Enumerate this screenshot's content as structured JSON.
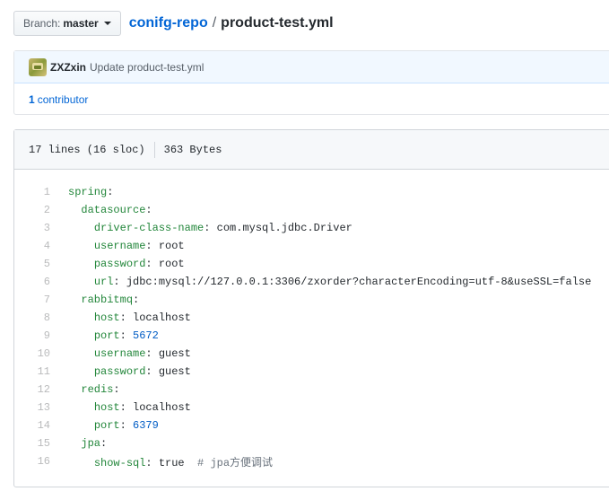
{
  "branch": {
    "prefix": "Branch:",
    "name": "master"
  },
  "breadcrumb": {
    "repo": "conifg-repo",
    "separator": "/",
    "file": "product-test.yml"
  },
  "commit": {
    "author": "ZXZxin",
    "message": "Update product-test.yml"
  },
  "contributors": {
    "count": "1",
    "label": "contributor"
  },
  "file_info": {
    "lines": "17 lines (16 sloc)",
    "size": "363 Bytes"
  },
  "code_lines": [
    {
      "n": "1",
      "indent": "",
      "key": "spring",
      "colon": ":",
      "value": "",
      "vclass": "",
      "comment": ""
    },
    {
      "n": "2",
      "indent": "  ",
      "key": "datasource",
      "colon": ":",
      "value": "",
      "vclass": "",
      "comment": ""
    },
    {
      "n": "3",
      "indent": "    ",
      "key": "driver-class-name",
      "colon": ": ",
      "value": "com.mysql.jdbc.Driver",
      "vclass": "",
      "comment": ""
    },
    {
      "n": "4",
      "indent": "    ",
      "key": "username",
      "colon": ": ",
      "value": "root",
      "vclass": "",
      "comment": ""
    },
    {
      "n": "5",
      "indent": "    ",
      "key": "password",
      "colon": ": ",
      "value": "root",
      "vclass": "",
      "comment": ""
    },
    {
      "n": "6",
      "indent": "    ",
      "key": "url",
      "colon": ": ",
      "value": "jdbc:mysql://127.0.0.1:3306/zxorder?characterEncoding=utf-8&useSSL=false",
      "vclass": "",
      "comment": ""
    },
    {
      "n": "7",
      "indent": "  ",
      "key": "rabbitmq",
      "colon": ":",
      "value": "",
      "vclass": "",
      "comment": ""
    },
    {
      "n": "8",
      "indent": "    ",
      "key": "host",
      "colon": ": ",
      "value": "localhost",
      "vclass": "",
      "comment": ""
    },
    {
      "n": "9",
      "indent": "    ",
      "key": "port",
      "colon": ": ",
      "value": "5672",
      "vclass": "n",
      "comment": ""
    },
    {
      "n": "10",
      "indent": "    ",
      "key": "username",
      "colon": ": ",
      "value": "guest",
      "vclass": "",
      "comment": ""
    },
    {
      "n": "11",
      "indent": "    ",
      "key": "password",
      "colon": ": ",
      "value": "guest",
      "vclass": "",
      "comment": ""
    },
    {
      "n": "12",
      "indent": "  ",
      "key": "redis",
      "colon": ":",
      "value": "",
      "vclass": "",
      "comment": ""
    },
    {
      "n": "13",
      "indent": "    ",
      "key": "host",
      "colon": ": ",
      "value": "localhost",
      "vclass": "",
      "comment": ""
    },
    {
      "n": "14",
      "indent": "    ",
      "key": "port",
      "colon": ": ",
      "value": "6379",
      "vclass": "n",
      "comment": ""
    },
    {
      "n": "15",
      "indent": "  ",
      "key": "jpa",
      "colon": ":",
      "value": "",
      "vclass": "",
      "comment": ""
    },
    {
      "n": "16",
      "indent": "    ",
      "key": "show-sql",
      "colon": ": ",
      "value": "true",
      "vclass": "",
      "comment": "  # jpa方便调试"
    }
  ],
  "colors": {
    "link": "#0366d6",
    "yaml_key": "#22863a",
    "yaml_number": "#005cc5",
    "comment": "#6a737d",
    "commit_bg": "#f1f8ff"
  }
}
